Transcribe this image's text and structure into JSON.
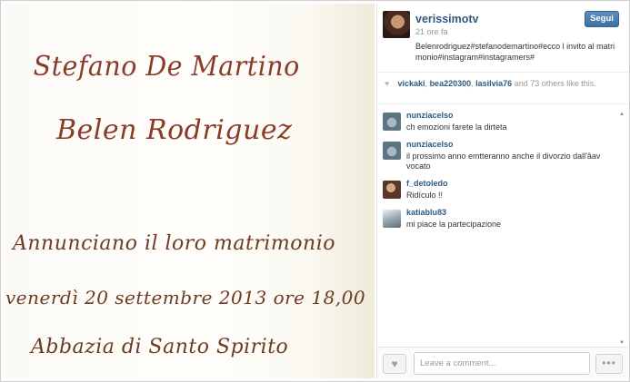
{
  "photo": {
    "lines": [
      "Stefano De Martino",
      "Belen Rodriguez",
      "Annunciano il loro matrimonio",
      "venerdì 20 settembre 2013 ore 18,00",
      "Abbazia di Santo Spirito"
    ]
  },
  "post": {
    "owner": "verissimotv",
    "time": "21 ore fa",
    "follow_label": "Segui",
    "caption": "Belenrodriguez#stefanodemartino#ecco l invito al matrimonio#instagram#instagramers#"
  },
  "likes": {
    "users": [
      "vickaki",
      "bea220300",
      "lasilvia76"
    ],
    "others_text": "and 73 others like this."
  },
  "comments": [
    {
      "user": "nunziacelso",
      "text": "ch emozioni farete la dirteta"
    },
    {
      "user": "nunziacelso",
      "text": "il prossimo anno emtteranno anche il divorzio dall'âav vocato"
    },
    {
      "user": "f_detoledo",
      "text": "Ridículo !!"
    },
    {
      "user": "katiablu83",
      "text": "mi piace la partecipazione"
    }
  ],
  "footer": {
    "comment_placeholder": "Leave a comment...",
    "more_label": "•••"
  },
  "icons": {
    "heart": "heart-icon",
    "more": "more-icon"
  }
}
